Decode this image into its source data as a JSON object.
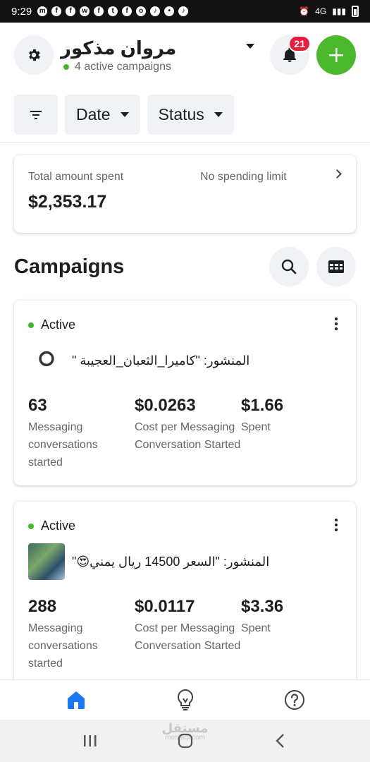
{
  "status_bar": {
    "time": "9:29",
    "network": "4G"
  },
  "header": {
    "account_name": "مروان مذكور",
    "active_campaigns": "4 active campaigns",
    "notification_count": "21"
  },
  "filters": {
    "date_label": "Date",
    "status_label": "Status"
  },
  "summary": {
    "label": "Total amount spent",
    "limit": "No spending limit",
    "amount": "$2,353.17"
  },
  "campaigns": {
    "title": "Campaigns",
    "items": [
      {
        "status": "Active",
        "post": "المنشور: \"كاميرا_الثعبان_العجيبة \"",
        "metrics": [
          {
            "value": "63",
            "label": "Messaging conversations started"
          },
          {
            "value": "$0.0263",
            "label": "Cost per Messaging Conversation Started"
          },
          {
            "value": "$1.66",
            "label": "Spent"
          }
        ]
      },
      {
        "status": "Active",
        "post": "المنشور: \"السعر 14500 ريال يمني😍\"",
        "metrics": [
          {
            "value": "288",
            "label": "Messaging conversations started"
          },
          {
            "value": "$0.0117",
            "label": "Cost per Messaging Conversation Started"
          },
          {
            "value": "$3.36",
            "label": "Spent"
          }
        ]
      }
    ]
  },
  "watermark": {
    "text": "مستقل",
    "sub": "mostaql.com"
  },
  "colors": {
    "accent_green": "#4cb82e",
    "active_dot": "#42b72a",
    "badge_red": "#e41e3f",
    "nav_active": "#1877f2"
  }
}
